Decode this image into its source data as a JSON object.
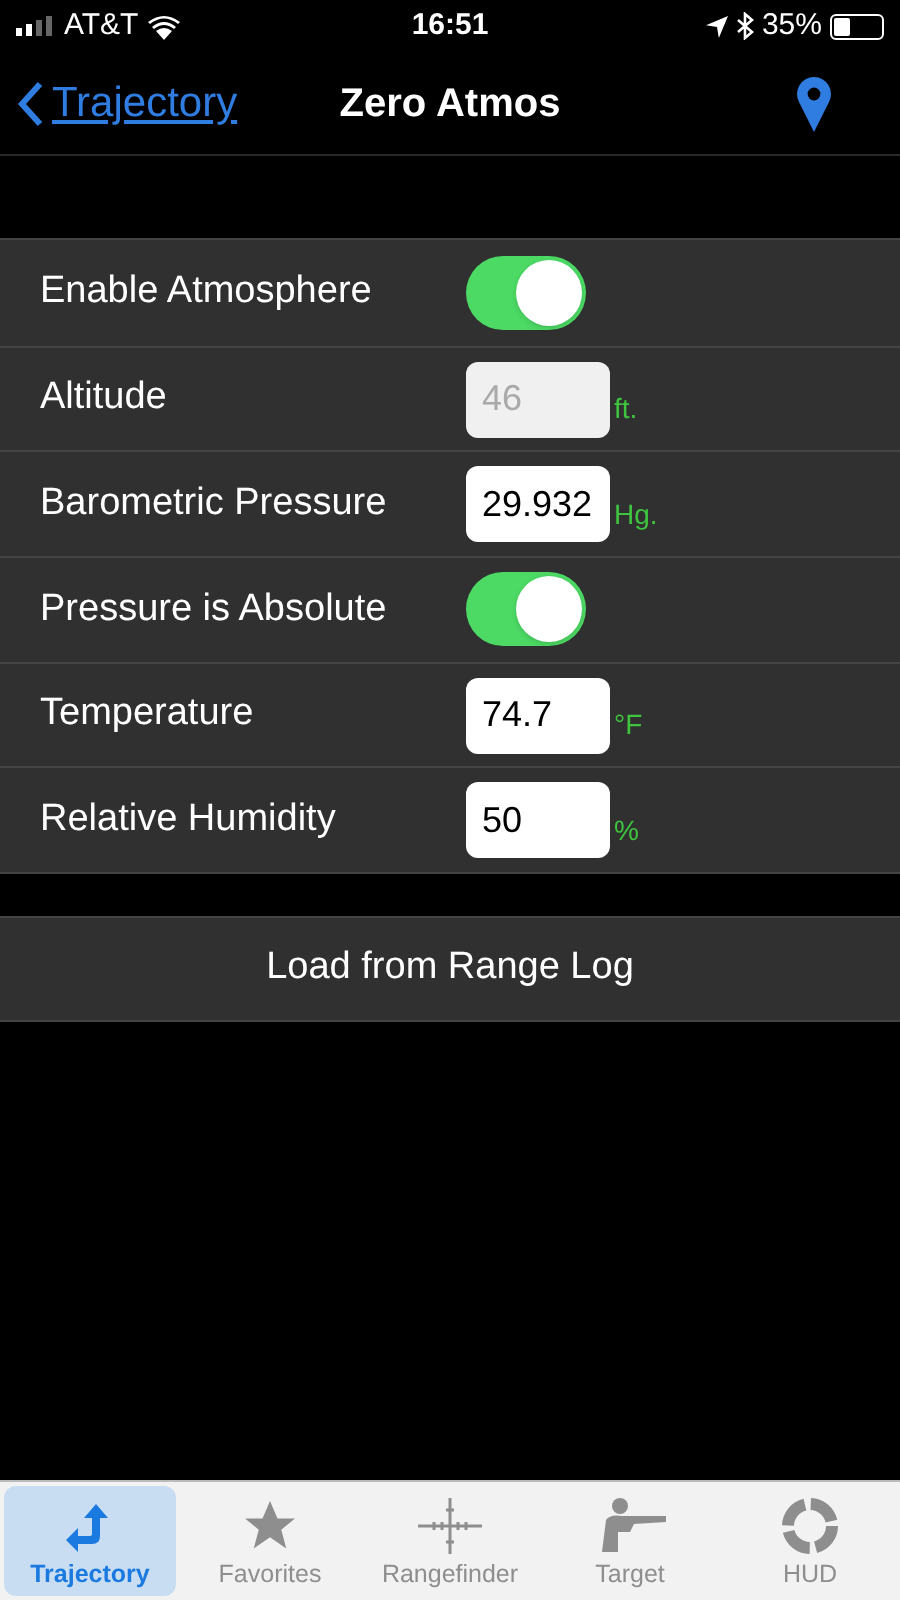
{
  "status_bar": {
    "carrier": "AT&T",
    "time": "16:51",
    "battery": "35%"
  },
  "nav": {
    "back": "Trajectory",
    "title": "Zero Atmos"
  },
  "rows": [
    {
      "kind": "toggle",
      "label": "Enable Atmosphere",
      "on": true
    },
    {
      "kind": "field",
      "label": "Altitude",
      "value": "46",
      "unit": "ft.",
      "disabled": true
    },
    {
      "kind": "field",
      "label": "Barometric Pressure",
      "value": "29.932",
      "unit": "Hg.",
      "disabled": false
    },
    {
      "kind": "toggle",
      "label": "Pressure is Absolute",
      "on": true
    },
    {
      "kind": "field",
      "label": "Temperature",
      "value": "74.7",
      "unit": "°F",
      "disabled": false
    },
    {
      "kind": "field",
      "label": "Relative Humidity",
      "value": "50",
      "unit": "%",
      "disabled": false
    }
  ],
  "load_button": "Load from Range Log",
  "tabs": [
    {
      "label": "Trajectory",
      "kind": "trajectory",
      "selected": true
    },
    {
      "label": "Favorites",
      "kind": "favorites",
      "selected": false
    },
    {
      "label": "Rangefinder",
      "kind": "rangefinder",
      "selected": false
    },
    {
      "label": "Target",
      "kind": "target",
      "selected": false
    },
    {
      "label": "HUD",
      "kind": "hud",
      "selected": false
    }
  ]
}
